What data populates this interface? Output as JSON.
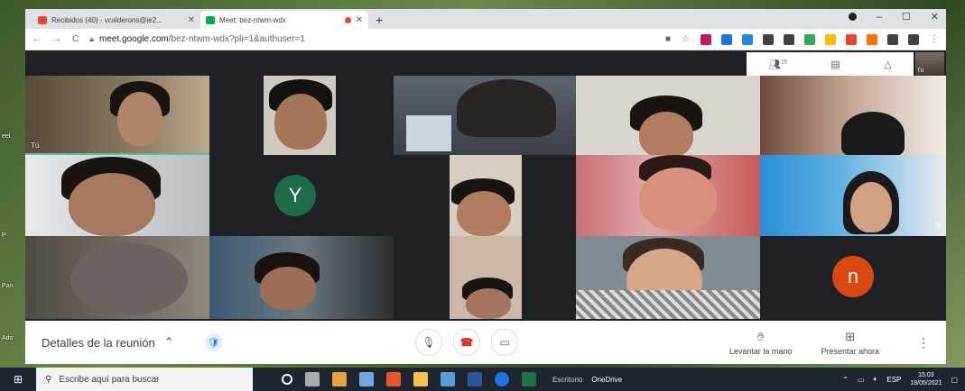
{
  "browser": {
    "tabs": [
      {
        "title": "Recibidos (40) - vcalderons@ie2...",
        "favicon_color": "#ea4335",
        "active": false
      },
      {
        "title": "Meet: bez-ntwm-wdx",
        "favicon_color": "#00ac47",
        "active": true
      }
    ],
    "new_tab": "+",
    "url_host": "meet.google.com",
    "url_path": "/bez-ntwm-wdx?pli=1&authuser=1",
    "extension_colors": [
      "#c2185b",
      "#1a73e8",
      "#1e88e5",
      "#424242",
      "#424242",
      "#34a853",
      "#fbbc04",
      "#ea4335",
      "#ff6f00",
      "#424242",
      "#424242"
    ]
  },
  "desktop_labels": [
    "eel",
    "P",
    "Pan",
    "Ado"
  ],
  "meet": {
    "participant_count": "15",
    "self_label": "Tú",
    "tiles": [
      {
        "id": "t1",
        "label": "Tú"
      },
      {
        "id": "t2",
        "avatar": "Y",
        "avatar_color": "#1e6b4a"
      },
      {
        "id": "t3",
        "avatar": "n",
        "avatar_color": "#d9480f"
      }
    ],
    "bottom": {
      "details_label": "Detalles de la reunión",
      "raise_hand_label": "Levantar la mano",
      "present_label": "Presentar ahora"
    }
  },
  "taskbar": {
    "search_placeholder": "Escribe aquí para buscar",
    "desktop_label": "Escritorio",
    "onedrive_label": "OneDrive",
    "lang": "ESP",
    "time": "15:03",
    "date": "19/05/2021"
  }
}
